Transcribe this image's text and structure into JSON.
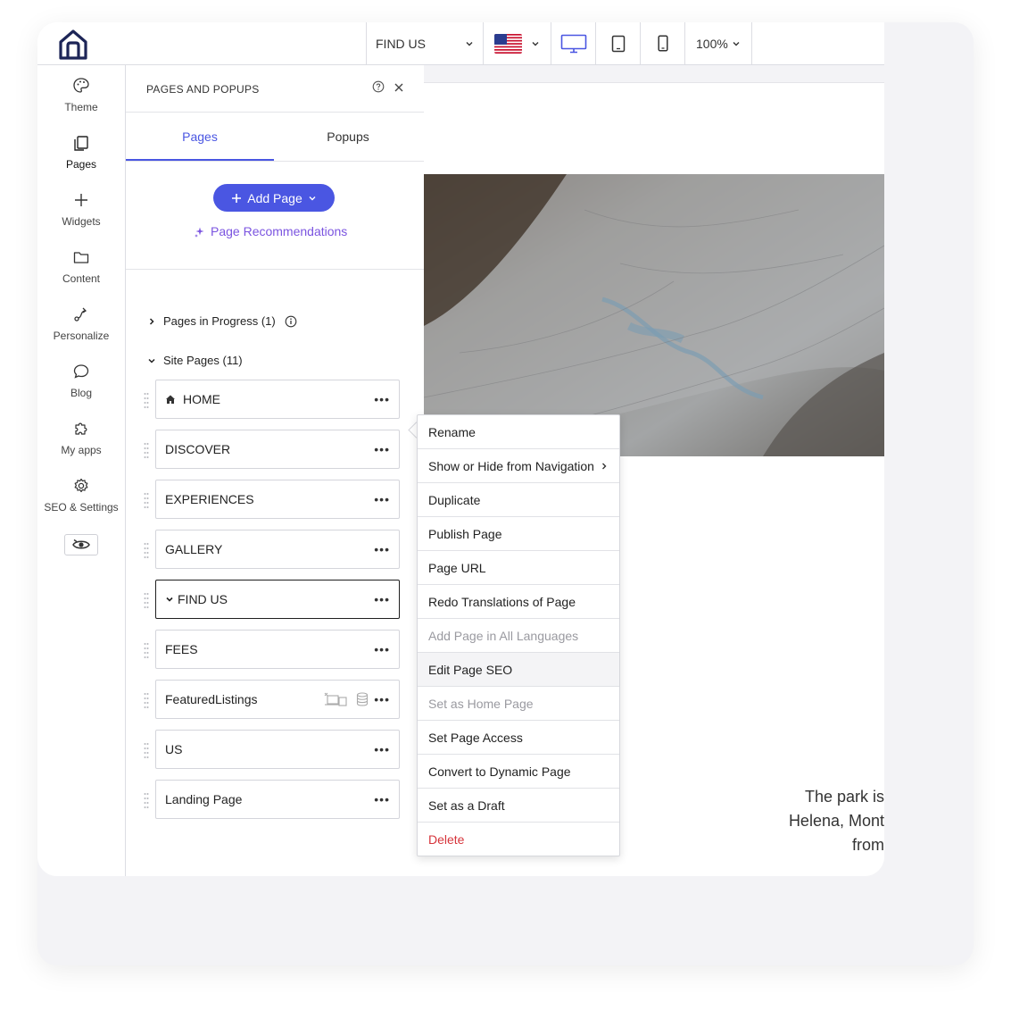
{
  "topbar": {
    "current_page": "FIND US",
    "zoom": "100%",
    "language_flag": "us-flag-icon",
    "active_device": "desktop"
  },
  "rail": {
    "items": [
      {
        "label": "Theme",
        "icon": "palette-icon"
      },
      {
        "label": "Pages",
        "icon": "pages-icon"
      },
      {
        "label": "Widgets",
        "icon": "plus-icon"
      },
      {
        "label": "Content",
        "icon": "folder-icon"
      },
      {
        "label": "Personalize",
        "icon": "personalize-icon"
      },
      {
        "label": "Blog",
        "icon": "chat-bubble-icon"
      },
      {
        "label": "My apps",
        "icon": "puzzle-icon"
      },
      {
        "label": "SEO & Settings",
        "icon": "gear-icon"
      }
    ]
  },
  "panel": {
    "title": "PAGES AND POPUPS",
    "tabs": [
      "Pages",
      "Popups"
    ],
    "add_page": "Add Page",
    "recommendations": "Page Recommendations",
    "in_progress": "Pages in Progress (1)",
    "site_pages": "Site Pages (11)",
    "pages": [
      {
        "name": "HOME"
      },
      {
        "name": "DISCOVER"
      },
      {
        "name": "EXPERIENCES"
      },
      {
        "name": "GALLERY"
      },
      {
        "name": "FIND US"
      },
      {
        "name": "FEES"
      },
      {
        "name": "FeaturedListings"
      },
      {
        "name": "US"
      },
      {
        "name": "Landing Page"
      }
    ]
  },
  "context_menu": {
    "items": [
      {
        "label": "Rename",
        "state": "enabled"
      },
      {
        "label": "Show or Hide from Navigation",
        "state": "enabled"
      },
      {
        "label": "Duplicate",
        "state": "enabled"
      },
      {
        "label": "Publish Page",
        "state": "enabled"
      },
      {
        "label": "Page URL",
        "state": "enabled"
      },
      {
        "label": "Redo Translations of Page",
        "state": "enabled"
      },
      {
        "label": "Add Page in All Languages",
        "state": "disabled"
      },
      {
        "label": "Edit Page SEO",
        "state": "hovered"
      },
      {
        "label": "Set as Home Page",
        "state": "disabled"
      },
      {
        "label": "Set Page Access",
        "state": "enabled"
      },
      {
        "label": "Convert to Dynamic Page",
        "state": "enabled"
      },
      {
        "label": "Set as a Draft",
        "state": "enabled"
      },
      {
        "label": "Delete",
        "state": "danger"
      }
    ]
  },
  "preview": {
    "text_lines": [
      "The park is",
      "Helena, Mont",
      "from"
    ]
  },
  "colors": {
    "accent": "#4a56e2",
    "recommend": "#7b54e0",
    "danger": "#d6343b"
  }
}
